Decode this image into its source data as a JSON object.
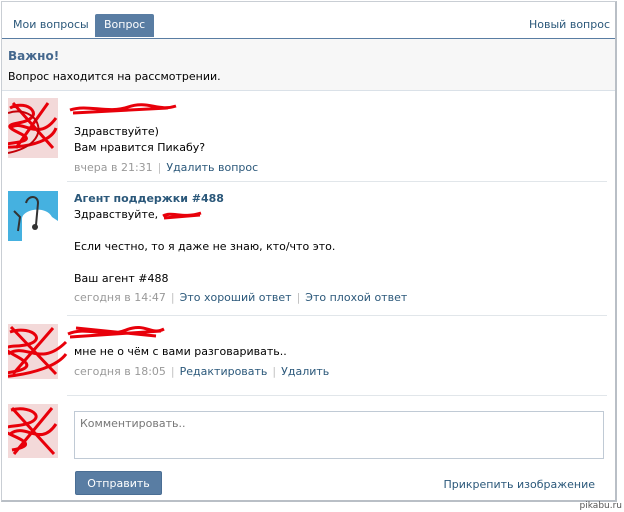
{
  "tabs": {
    "my_questions": "Мои вопросы",
    "question": "Вопрос",
    "new_question": "Новый вопрос"
  },
  "notice": {
    "title": "Важно!",
    "text": "Вопрос находится на рассмотрении."
  },
  "posts": [
    {
      "lines": [
        "Здравствуйте)",
        "Вам нравится Пикабу?"
      ],
      "time": "вчера в 21:31",
      "actions": [
        "Удалить вопрос"
      ]
    },
    {
      "author": "Агент поддержки #488",
      "greeting": "Здравствуйте,",
      "lines": [
        "Если честно, то я даже не знаю, кто/что это.",
        "Ваш агент #488"
      ],
      "time": "сегодня в 14:47",
      "actions": [
        "Это хороший ответ",
        "Это плохой ответ"
      ]
    },
    {
      "lines": [
        "мне не о чём с вами разговаривать.."
      ],
      "time": "сегодня в 18:05",
      "actions": [
        "Редактировать",
        "Удалить"
      ]
    }
  ],
  "composer": {
    "placeholder": "Комментировать..",
    "send_label": "Отправить",
    "attach_label": "Прикрепить изображение"
  },
  "watermark": "pikabu.ru",
  "colors": {
    "accent": "#597da3",
    "link": "#2b587a",
    "scribble": "#e8000a"
  }
}
